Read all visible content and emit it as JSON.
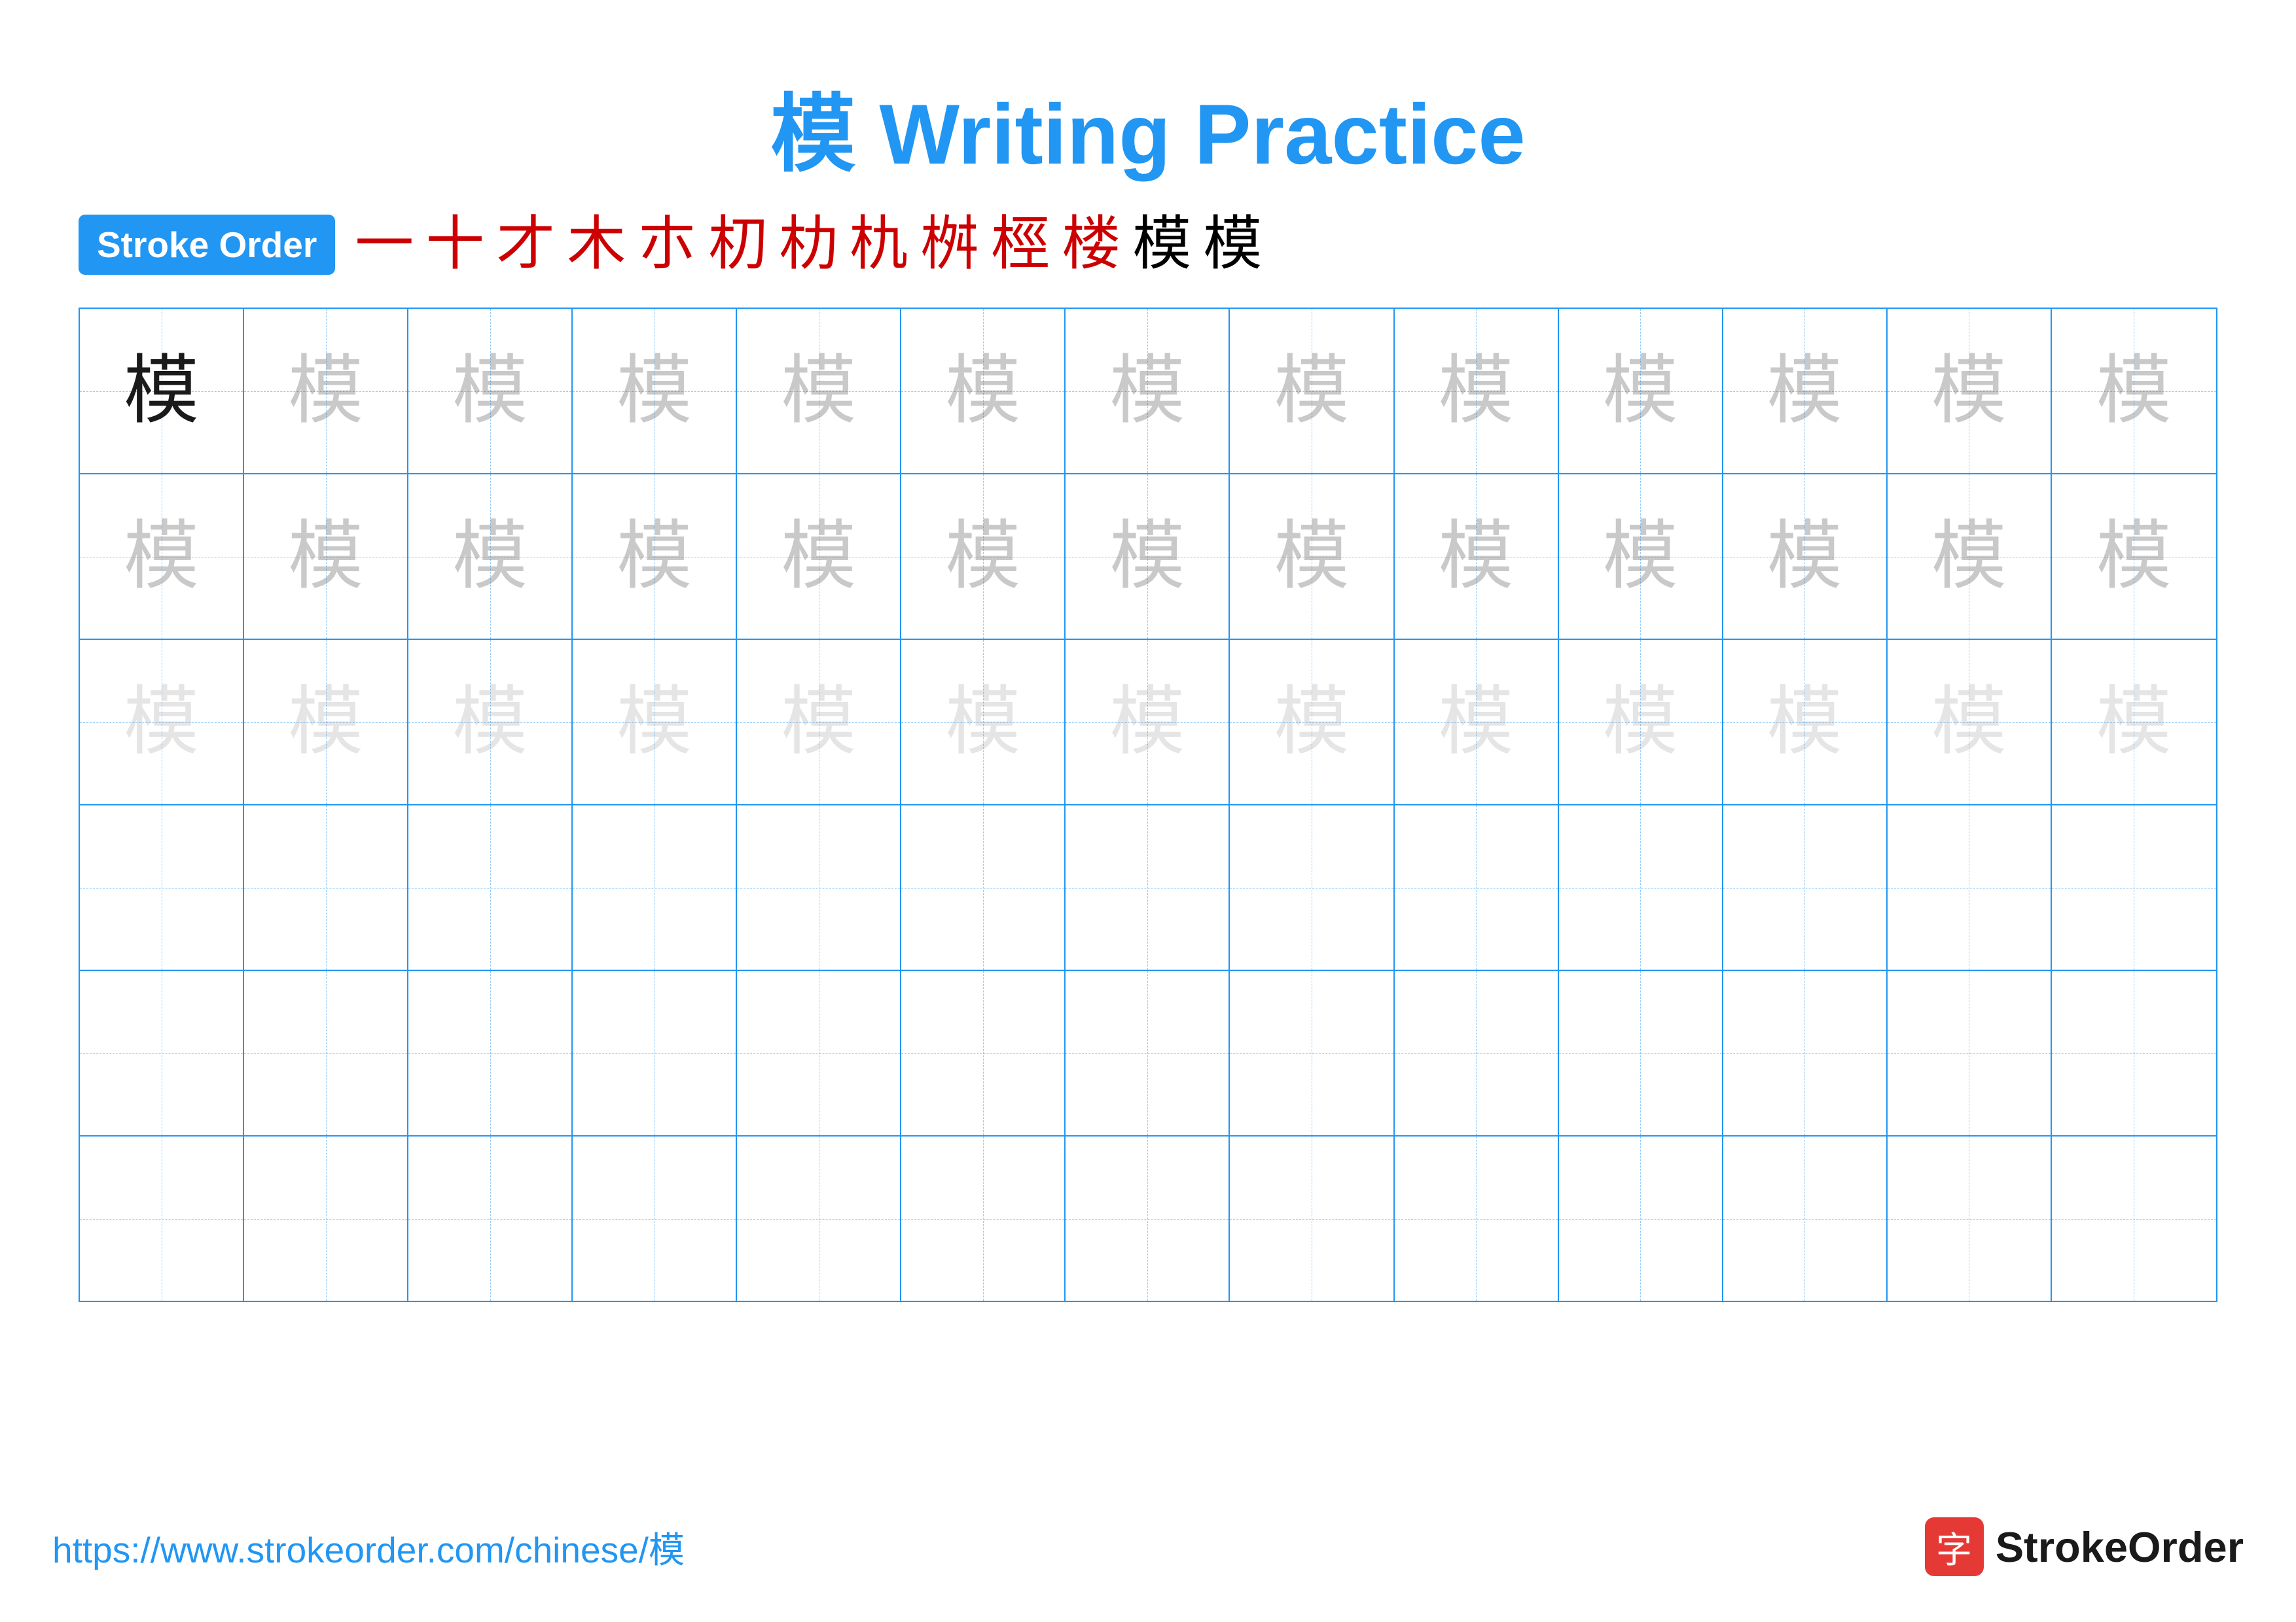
{
  "title": "模 Writing Practice",
  "stroke_order_label": "Stroke Order",
  "stroke_chars": [
    "一",
    "十",
    "才",
    "木",
    "朩",
    "朷",
    "朸",
    "朹",
    "桝",
    "桱",
    "楼",
    "模",
    "模"
  ],
  "char": "模",
  "rows": [
    {
      "type": "solid_then_faded_dark",
      "count": 13
    },
    {
      "type": "faded_dark",
      "count": 13
    },
    {
      "type": "faded_light",
      "count": 13
    },
    {
      "type": "empty",
      "count": 13
    },
    {
      "type": "empty",
      "count": 13
    },
    {
      "type": "empty",
      "count": 13
    }
  ],
  "footer_url": "https://www.strokeorder.com/chinese/模",
  "brand_char": "字",
  "brand_name": "StrokeOrder"
}
